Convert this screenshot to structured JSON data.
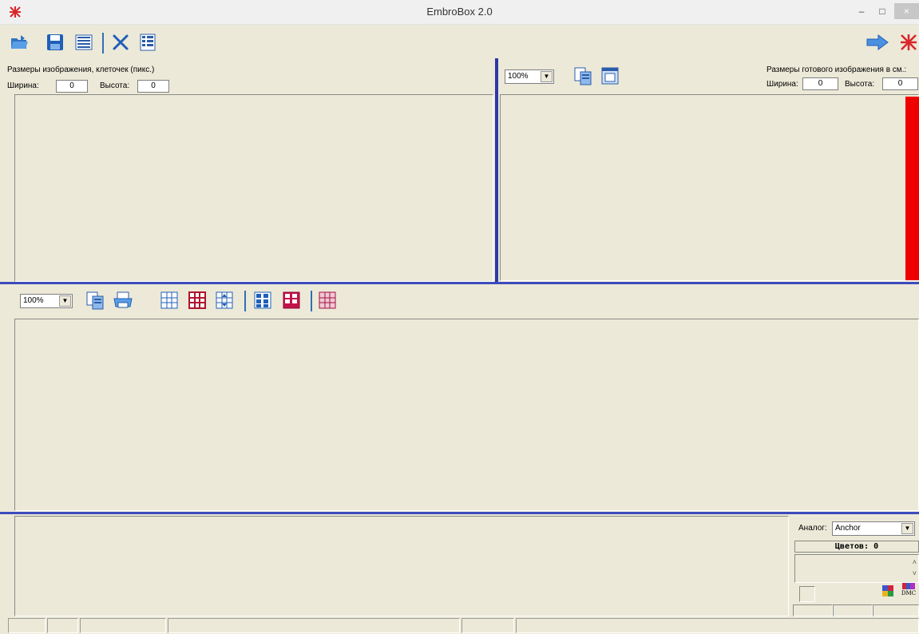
{
  "window": {
    "title": "EmbroBox 2.0",
    "minimize": "–",
    "maximize": "□",
    "close": "×"
  },
  "colors": {
    "divider": "#3c4bbd",
    "red_scale": "#ee0000",
    "bg": "#ece9d8"
  },
  "toolbar": {
    "icons": [
      "open-folder-icon",
      "save-icon",
      "grid-table-icon",
      "settings-tools-icon",
      "palette-list-icon",
      "next-arrow-icon",
      "embroidery-logo-icon"
    ]
  },
  "source_panel": {
    "heading": "Размеры изображения, клеточек (пикс.)",
    "width_label": "Ширина:",
    "width_value": "0",
    "height_label": "Высота:",
    "height_value": "0"
  },
  "result_panel": {
    "zoom": "100%",
    "heading": "Размеры готового изображения в см.:",
    "width_label": "Ширина:",
    "width_value": "0",
    "height_label": "Высота:",
    "height_value": "0"
  },
  "scheme_panel": {
    "zoom": "100%"
  },
  "palette_panel": {
    "analog_label": "Аналог:",
    "analog_value": "Anchor",
    "colors_count": "Цветов: 0",
    "dmc_label": "DMC"
  }
}
